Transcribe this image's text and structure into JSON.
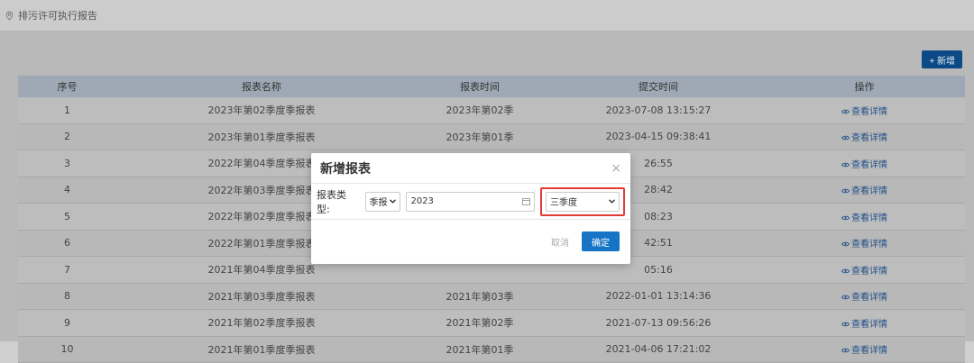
{
  "breadcrumb": {
    "label": "排污许可执行报告"
  },
  "toolbar": {
    "add_label": "+ 新增"
  },
  "table": {
    "headers": [
      "序号",
      "报表名称",
      "报表时间",
      "提交时间",
      "操作"
    ],
    "rows": [
      {
        "index": "1",
        "name": "2023年第02季度季报表",
        "period": "2023年第02季",
        "submitted": "2023-07-08 13:15:27",
        "action": "查看详情"
      },
      {
        "index": "2",
        "name": "2023年第01季度季报表",
        "period": "2023年第01季",
        "submitted": "2023-04-15 09:38:41",
        "action": "查看详情"
      },
      {
        "index": "3",
        "name": "2022年第04季度季报表",
        "period": "",
        "submitted": "26:55",
        "action": "查看详情"
      },
      {
        "index": "4",
        "name": "2022年第03季度季报表",
        "period": "",
        "submitted": "28:42",
        "action": "查看详情"
      },
      {
        "index": "5",
        "name": "2022年第02季度季报表",
        "period": "",
        "submitted": "08:23",
        "action": "查看详情"
      },
      {
        "index": "6",
        "name": "2022年第01季度季报表",
        "period": "",
        "submitted": "42:51",
        "action": "查看详情"
      },
      {
        "index": "7",
        "name": "2021年第04季度季报表",
        "period": "",
        "submitted": "05:16",
        "action": "查看详情"
      },
      {
        "index": "8",
        "name": "2021年第03季度季报表",
        "period": "2021年第03季",
        "submitted": "2022-01-01 13:14:36",
        "action": "查看详情"
      },
      {
        "index": "9",
        "name": "2021年第02季度季报表",
        "period": "2021年第02季",
        "submitted": "2021-07-13 09:56:26",
        "action": "查看详情"
      },
      {
        "index": "10",
        "name": "2021年第01季度季报表",
        "period": "2021年第01季",
        "submitted": "2021-04-06 17:21:02",
        "action": "查看详情"
      }
    ]
  },
  "modal": {
    "title": "新增报表",
    "close": "×",
    "type_label": "报表类型:",
    "type_value": "季报",
    "year_value": "2023",
    "quarter_value": "三季度",
    "cancel_label": "取消",
    "ok_label": "确定"
  },
  "colors": {
    "primary": "#1674c6",
    "highlight": "#e53935"
  }
}
